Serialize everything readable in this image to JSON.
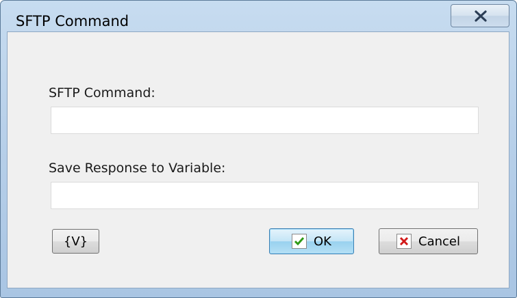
{
  "window": {
    "title": "SFTP Command"
  },
  "form": {
    "command_label": "SFTP Command:",
    "command_value": "",
    "response_label": "Save Response to Variable:",
    "response_value": ""
  },
  "buttons": {
    "variables_label": "{V}",
    "ok_label": "OK",
    "cancel_label": "Cancel"
  },
  "icons": {
    "close": "close-icon",
    "ok": "checkmark-icon",
    "cancel": "x-icon"
  },
  "colors": {
    "title_bar": "#b9d1ea",
    "client_bg": "#f0f0f0",
    "ok_check": "#2e9a16",
    "cancel_x": "#d21a1a"
  }
}
